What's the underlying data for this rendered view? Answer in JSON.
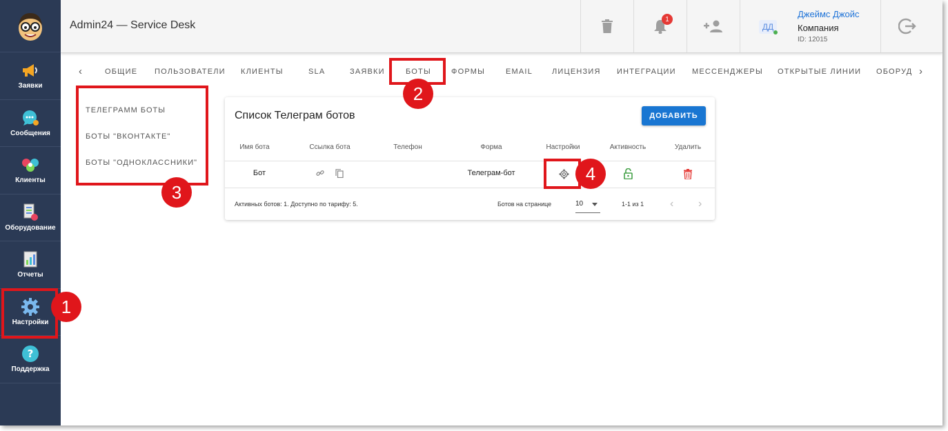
{
  "header": {
    "title": "Admin24 — Service Desk",
    "notifications_count": "1",
    "user": {
      "avatar_initials": "ДД",
      "name": "Джеймс Джойс",
      "company": "Компания",
      "id": "ID: 12015"
    }
  },
  "sidebar": {
    "items": [
      {
        "label": "Заявки",
        "icon": "megaphone-icon"
      },
      {
        "label": "Сообщения",
        "icon": "chat-icon"
      },
      {
        "label": "Клиенты",
        "icon": "clients-icon"
      },
      {
        "label": "Оборудование",
        "icon": "equipment-icon"
      },
      {
        "label": "Отчеты",
        "icon": "reports-icon"
      },
      {
        "label": "Настройки",
        "icon": "gear-icon"
      },
      {
        "label": "Поддержка",
        "icon": "help-icon"
      }
    ]
  },
  "tabs": [
    "ОБЩИЕ",
    "ПОЛЬЗОВАТЕЛИ",
    "КЛИЕНТЫ",
    "SLA",
    "ЗАЯВКИ",
    "БОТЫ",
    "ФОРМЫ",
    "EMAIL",
    "ЛИЦЕНЗИЯ",
    "ИНТЕГРАЦИИ",
    "МЕССЕНДЖЕРЫ",
    "ОТКРЫТЫЕ ЛИНИИ",
    "ОБОРУД"
  ],
  "submenu": [
    "ТЕЛЕГРАММ БОТЫ",
    "БОТЫ \"ВКОНТАКТЕ\"",
    "БОТЫ \"ОДНОКЛАССНИКИ\""
  ],
  "card": {
    "title": "Список Телеграм ботов",
    "add_label": "ДОБАВИТЬ",
    "columns": [
      "Имя бота",
      "Ссылка бота",
      "Телефон",
      "Форма",
      "Настройки",
      "Активность",
      "Удалить"
    ],
    "row": {
      "name": "Бот",
      "phone": "",
      "form": "Телеграм-бот"
    },
    "footer": {
      "summary": "Активных ботов: 1. Доступно по тарифу: 5.",
      "per_page_label": "Ботов на странице",
      "per_page_value": "10",
      "range": "1-1 из 1"
    }
  },
  "annotations": [
    "1",
    "2",
    "3",
    "4"
  ],
  "colors": {
    "sidebar": "#2b3a55",
    "accent": "#1976d2",
    "highlight": "#e0161b",
    "active": "#43a047",
    "delete": "#e53935"
  }
}
